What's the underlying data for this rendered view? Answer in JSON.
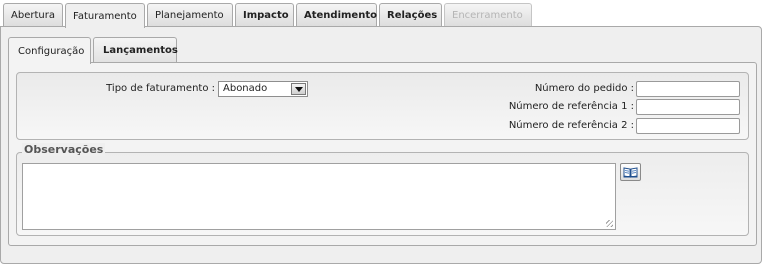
{
  "tabs": [
    {
      "label": "Abertura"
    },
    {
      "label": "Faturamento"
    },
    {
      "label": "Planejamento"
    },
    {
      "label": "Impacto"
    },
    {
      "label": "Atendimento"
    },
    {
      "label": "Relações"
    },
    {
      "label": "Encerramento"
    }
  ],
  "subtabs": [
    {
      "label": "Configuração"
    },
    {
      "label": "Lançamentos"
    }
  ],
  "form": {
    "tipo_label": "Tipo de faturamento :",
    "tipo_value": "Abonado",
    "pedido_label": "Número do pedido :",
    "ref1_label": "Número de referência 1 :",
    "ref2_label": "Número de referência 2 :",
    "pedido_value": "",
    "ref1_value": "",
    "ref2_value": ""
  },
  "observacoes": {
    "legend": "Observações",
    "value": ""
  },
  "icons": {
    "book": "book-icon",
    "dropdown": "chevron-down-icon"
  }
}
